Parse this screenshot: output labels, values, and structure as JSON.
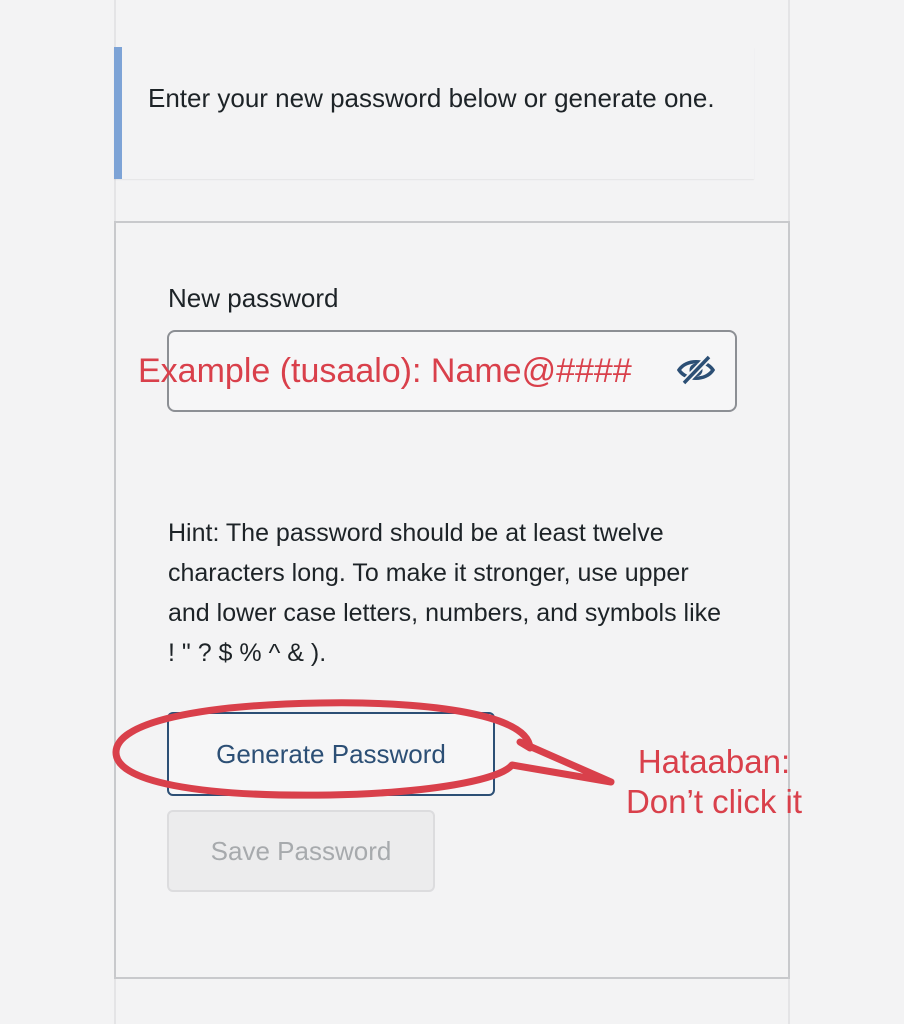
{
  "message": {
    "text": "Enter your new password below or generate one."
  },
  "form": {
    "new_password_label": "New password",
    "password_value": "",
    "hint": "Hint: The password should be at least twelve characters long. To make it stronger, use upper and lower case letters, numbers, and symbols like ! \" ? $ % ^ & ).",
    "generate_label": "Generate Password",
    "save_label": "Save Password"
  },
  "annotations": {
    "example": "Example (tusaalo): Name@####",
    "warning": "Hataaban: Don’t click it"
  },
  "icons": {
    "visibility_toggle": "eye-slash-icon"
  },
  "colors": {
    "accent_border": "#7da3d6",
    "button_text": "#2c4f75",
    "annotation_red": "#d9404b"
  }
}
